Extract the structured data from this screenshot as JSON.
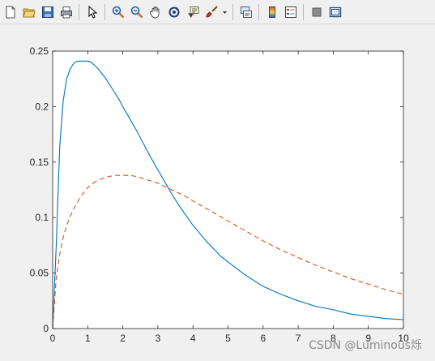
{
  "toolbar": {
    "buttons": [
      {
        "name": "new-figure-icon"
      },
      {
        "name": "open-file-icon"
      },
      {
        "name": "save-icon"
      },
      {
        "name": "print-icon"
      },
      {
        "sep": true
      },
      {
        "name": "edit-plot-arrow-icon"
      },
      {
        "sep": true
      },
      {
        "name": "zoom-in-icon"
      },
      {
        "name": "zoom-out-icon"
      },
      {
        "name": "pan-hand-icon"
      },
      {
        "name": "rotate-3d-icon"
      },
      {
        "name": "data-cursor-icon"
      },
      {
        "name": "brush-icon"
      },
      {
        "name": "brush-dropdown-icon"
      },
      {
        "sep": true
      },
      {
        "name": "link-plot-icon"
      },
      {
        "sep": true
      },
      {
        "name": "colorbar-icon"
      },
      {
        "name": "legend-icon"
      },
      {
        "sep": true
      },
      {
        "name": "hide-plot-tools-icon"
      },
      {
        "name": "show-plot-tools-icon"
      }
    ]
  },
  "watermark": "CSDN @Luminous烁",
  "chart_data": {
    "type": "line",
    "title": "",
    "xlabel": "",
    "ylabel": "",
    "xlim": [
      0,
      10
    ],
    "ylim": [
      0,
      0.25
    ],
    "xticks": [
      0,
      1,
      2,
      3,
      4,
      5,
      6,
      7,
      8,
      9,
      10
    ],
    "xtick_labels": [
      "0",
      "1",
      "2",
      "3",
      "4",
      "5",
      "6",
      "7",
      "8",
      "9",
      "10"
    ],
    "yticks": [
      0,
      0.05,
      0.1,
      0.15,
      0.2,
      0.25
    ],
    "ytick_labels": [
      "0",
      "0.05",
      "0.1",
      "0.15",
      "0.2",
      "0.25"
    ],
    "grid": false,
    "series": [
      {
        "color": "#0072bd",
        "dash": "solid",
        "x": [
          0,
          0.1,
          0.2,
          0.3,
          0.4,
          0.5,
          0.6,
          0.7,
          0.8,
          0.9,
          1.0,
          1.1,
          1.2,
          1.3,
          1.4,
          1.5,
          1.6,
          1.7,
          1.8,
          1.9,
          2.0,
          2.2,
          2.4,
          2.6,
          2.8,
          3.0,
          3.2,
          3.4,
          3.6,
          3.8,
          4.0,
          4.4,
          4.8,
          5.0,
          5.5,
          6.0,
          6.5,
          7.0,
          7.5,
          8.0,
          8.5,
          9.0,
          9.5,
          10.0
        ],
        "values": [
          0,
          0.073,
          0.163,
          0.205,
          0.225,
          0.234,
          0.239,
          0.241,
          0.241,
          0.241,
          0.241,
          0.24,
          0.237,
          0.234,
          0.23,
          0.226,
          0.221,
          0.216,
          0.211,
          0.206,
          0.2,
          0.189,
          0.178,
          0.166,
          0.154,
          0.143,
          0.132,
          0.121,
          0.111,
          0.102,
          0.093,
          0.078,
          0.065,
          0.06,
          0.048,
          0.038,
          0.031,
          0.025,
          0.02,
          0.017,
          0.013,
          0.011,
          0.009,
          0.008
        ]
      },
      {
        "color": "#d95319",
        "dash": "dashed",
        "x": [
          0,
          0.1,
          0.2,
          0.3,
          0.4,
          0.5,
          0.6,
          0.8,
          1.0,
          1.2,
          1.4,
          1.6,
          1.8,
          2.0,
          2.2,
          2.4,
          2.6,
          2.8,
          3.0,
          3.2,
          3.4,
          3.6,
          3.8,
          4.0,
          4.5,
          5.0,
          5.5,
          6.0,
          6.5,
          7.0,
          7.5,
          8.0,
          8.5,
          9.0,
          9.5,
          10.0
        ],
        "values": [
          0,
          0.045,
          0.067,
          0.082,
          0.093,
          0.101,
          0.108,
          0.119,
          0.127,
          0.132,
          0.135,
          0.137,
          0.138,
          0.138,
          0.138,
          0.137,
          0.135,
          0.133,
          0.131,
          0.128,
          0.125,
          0.122,
          0.119,
          0.115,
          0.106,
          0.097,
          0.088,
          0.079,
          0.071,
          0.064,
          0.057,
          0.051,
          0.045,
          0.04,
          0.035,
          0.031
        ]
      }
    ]
  }
}
